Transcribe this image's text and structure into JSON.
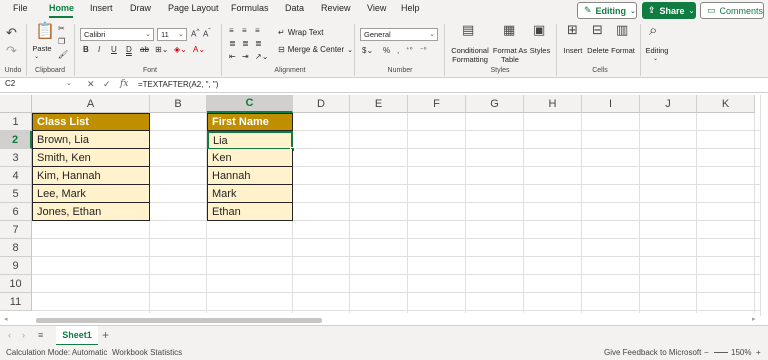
{
  "menu": {
    "tabs": [
      "File",
      "Home",
      "Insert",
      "Draw",
      "Page Layout",
      "Formulas",
      "Data",
      "Review",
      "View",
      "Help"
    ],
    "editing_label": "Editing",
    "share_label": "Share",
    "comments_label": "Comments"
  },
  "ribbon": {
    "undo_label": "Undo",
    "clipboard_label": "Clipboard",
    "paste_label": "Paste",
    "font_label": "Font",
    "font_name": "Calibri",
    "font_size": "11",
    "alignment_label": "Alignment",
    "wrap_text_label": "Wrap Text",
    "merge_center_label": "Merge & Center",
    "number_label": "Number",
    "number_format": "General",
    "styles_label": "Styles",
    "conditional_formatting_label": "Conditional Formatting",
    "format_as_table_label": "Format As Table",
    "styles_button_label": "Styles",
    "cells_label": "Cells",
    "insert_label": "Insert",
    "delete_label": "Delete",
    "format_label": "Format",
    "editing_group_label": "Editing"
  },
  "formula_bar": {
    "name_box": "C2",
    "fx": "fx",
    "formula": "=TEXTAFTER(A2, \", \")"
  },
  "grid": {
    "columns": [
      "A",
      "B",
      "C",
      "D",
      "E",
      "F",
      "G",
      "H",
      "I",
      "J",
      "K"
    ],
    "rows": [
      "1",
      "2",
      "3",
      "4",
      "5",
      "6",
      "7",
      "8",
      "9",
      "10",
      "11"
    ],
    "selected_column": "C",
    "selected_row": "2",
    "col_a_header": "Class List",
    "col_a_values": [
      "Brown, Lia",
      "Smith, Ken",
      "Kim, Hannah",
      "Lee, Mark",
      "Jones, Ethan"
    ],
    "col_c_header": "First Name",
    "col_c_values": [
      "Lia",
      "Ken",
      "Hannah",
      "Mark",
      "Ethan"
    ]
  },
  "sheets": {
    "active": "Sheet1",
    "add_label": "+"
  },
  "status": {
    "calc_mode": "Calculation Mode: Automatic",
    "workbook_stats": "Workbook Statistics",
    "feedback": "Give Feedback to Microsoft",
    "zoom": "150%"
  },
  "colors": {
    "accent": "#107c41",
    "header_fill": "#bf8f00",
    "data_fill": "#fff2cc"
  }
}
